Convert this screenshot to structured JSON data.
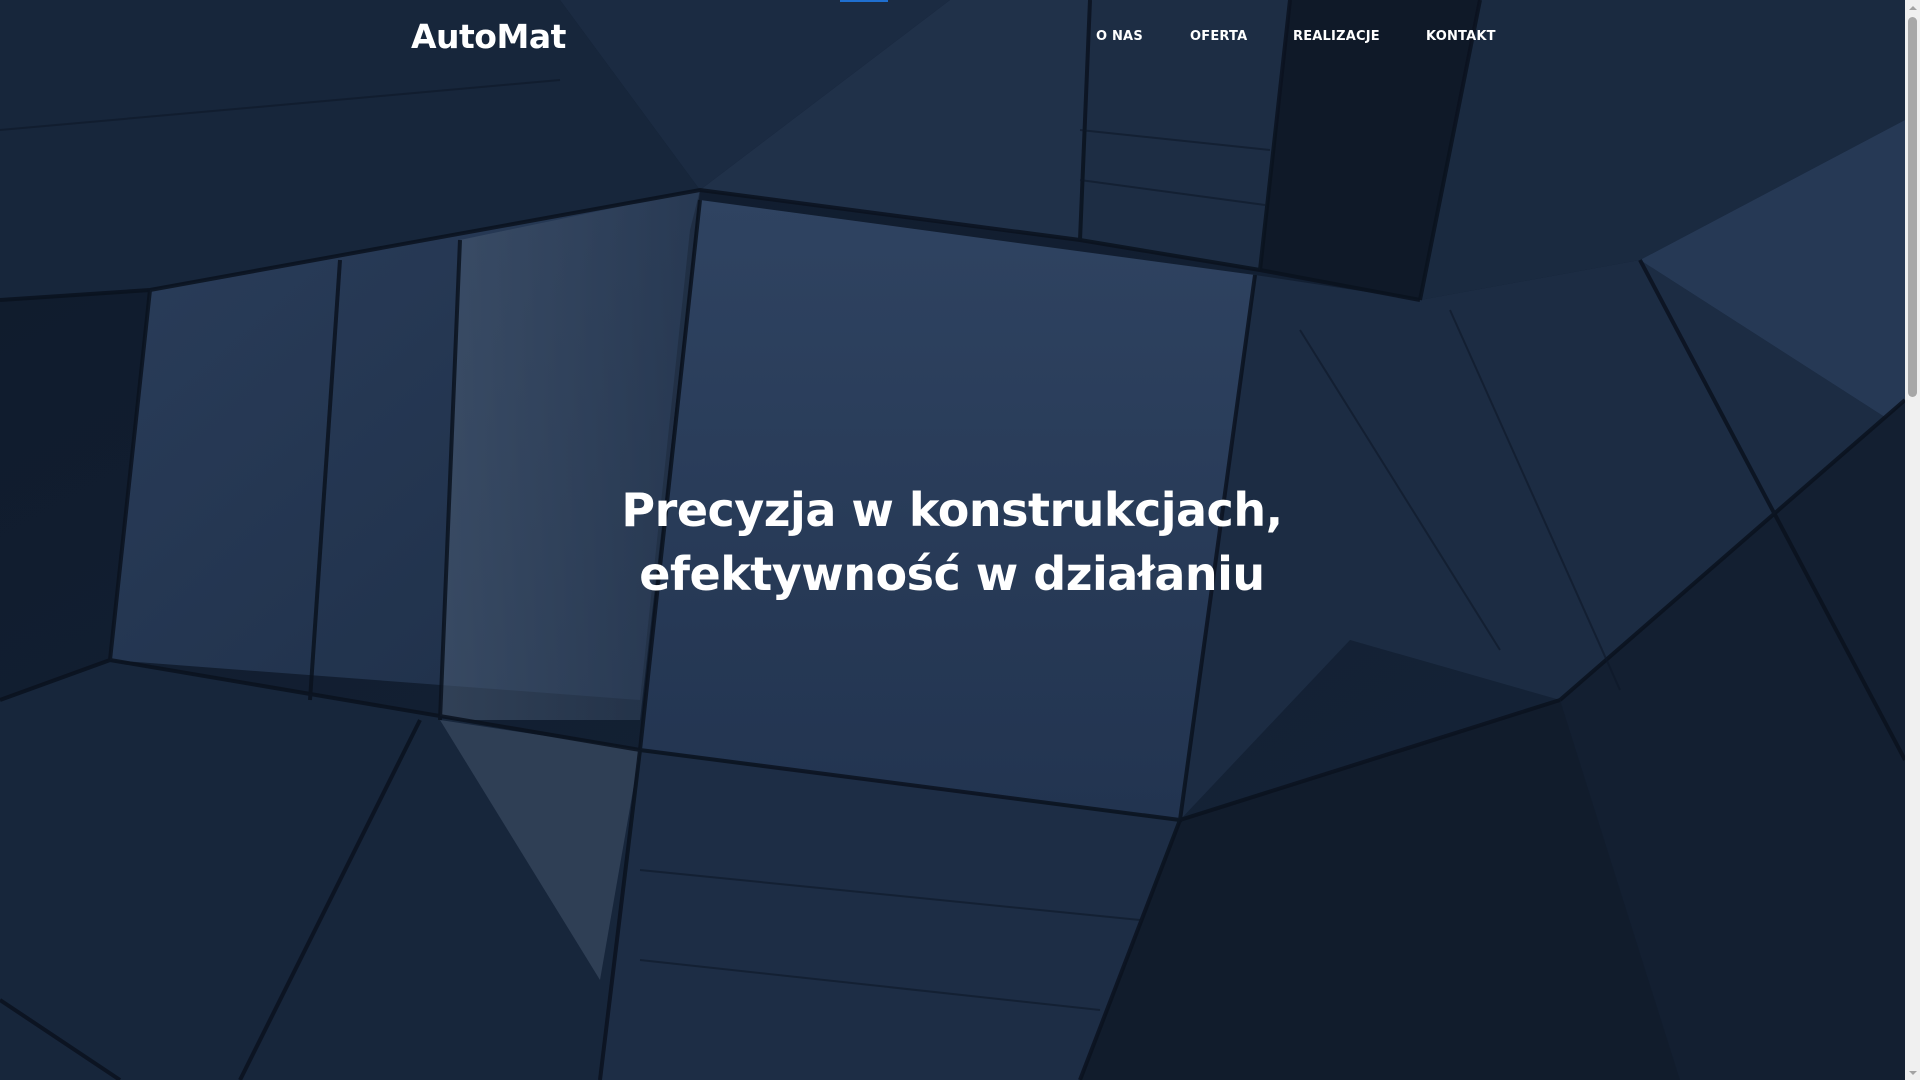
{
  "colors": {
    "accent": "#1f6fd0",
    "text": "#ffffff",
    "background": "#1a2a40"
  },
  "header": {
    "logo": "AutoMat",
    "nav": [
      {
        "label": "O NAS"
      },
      {
        "label": "OFERTA"
      },
      {
        "label": "REALIZACJE"
      },
      {
        "label": "KONTAKT"
      }
    ]
  },
  "hero": {
    "headline_line1": "Precyzja w konstrukcjach,",
    "headline_line2": "efektywność w działaniu",
    "background_image": "dark-blue-geometric-glass-architecture"
  },
  "scrollbar": {
    "up_icon": "chevron-up-icon",
    "down_icon": "chevron-down-icon"
  }
}
